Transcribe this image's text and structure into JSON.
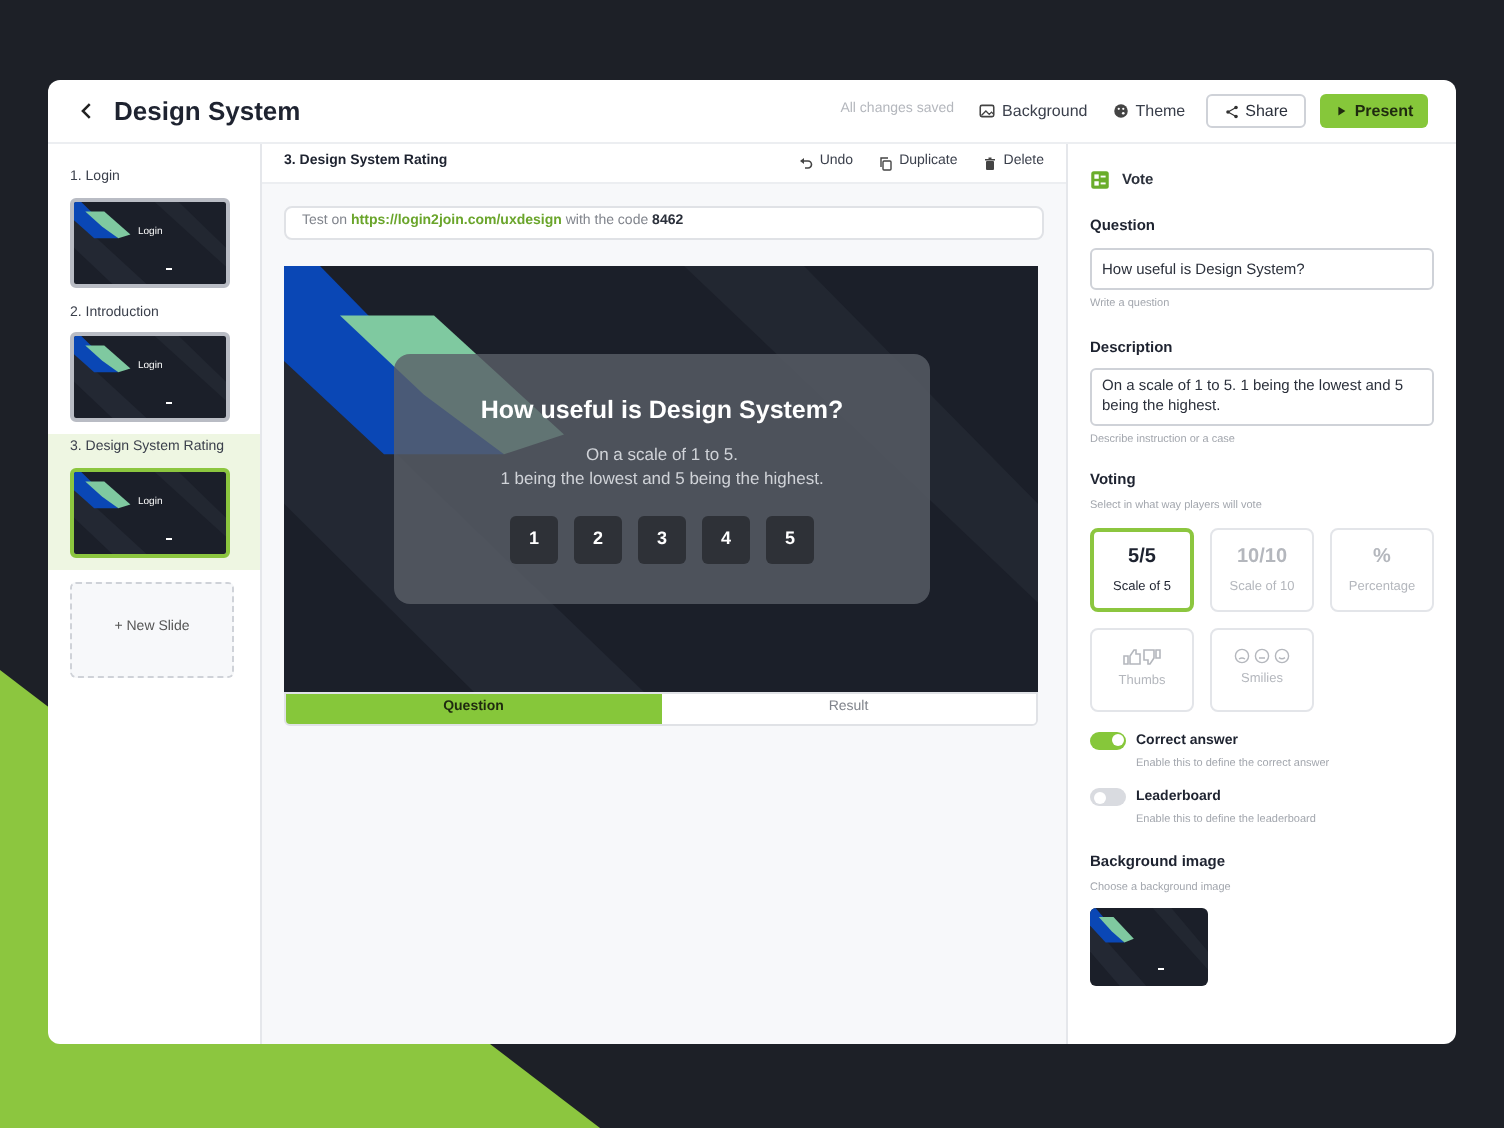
{
  "header": {
    "title": "Design System",
    "save_status": "All changes saved",
    "actions": [
      {
        "kind": "image",
        "label": "Background"
      },
      {
        "kind": "palette",
        "label": "Theme"
      }
    ],
    "share": "Share",
    "present": "Present"
  },
  "sidebar": {
    "slides": [
      {
        "label": "1. Login",
        "thumbnail_text": "Login",
        "selected": false
      },
      {
        "label": "2. Introduction",
        "thumbnail_text": "Login",
        "selected": false
      },
      {
        "label": "3. Design System Rating",
        "thumbnail_text": "Login",
        "selected": true
      }
    ],
    "new_slide": "+ New Slide"
  },
  "toolbar": {
    "title": "3. Design System Rating",
    "actions": [
      {
        "kind": "undo",
        "label": "Undo"
      },
      {
        "kind": "copy",
        "label": "Duplicate"
      },
      {
        "kind": "trash",
        "label": "Delete"
      }
    ]
  },
  "test_bar": {
    "prefix": "Test on",
    "url": "https://login2join.com/uxdesign",
    "suffix": "with the code **8462**"
  },
  "slide": {
    "question": "How useful is Design System?",
    "description_lines": [
      "On a scale of 1 to 5.",
      "1 being the lowest and 5 being the highest."
    ],
    "options": [
      "1",
      "2",
      "3",
      "4",
      "5"
    ]
  },
  "slide_tabs": [
    {
      "label": "Question",
      "selected": true
    },
    {
      "label": "Result",
      "selected": false
    }
  ],
  "panel": {
    "type_label": "Vote",
    "fields": [
      {
        "kind": "input",
        "label": "Question",
        "value": "How useful is Design System?",
        "hint": "Write a question"
      },
      {
        "kind": "textarea",
        "label": "Description",
        "value": "On a scale of 1 to 5. 1 being the lowest and 5 being the highest.",
        "hint": "Describe instruction or a case"
      }
    ],
    "voting": {
      "label": "Voting",
      "hint": "Select in what way players will vote",
      "options": [
        {
          "kind": "text",
          "symbol": "5/5",
          "label": "Scale of 5",
          "selected": true
        },
        {
          "kind": "text",
          "symbol": "10/10",
          "label": "Scale of 10",
          "selected": false
        },
        {
          "kind": "text",
          "symbol": "%",
          "label": "Percentage",
          "selected": false
        },
        {
          "kind": "thumbs",
          "label": "Thumbs",
          "selected": false
        },
        {
          "kind": "smilies",
          "label": "Smilies",
          "selected": false
        }
      ]
    },
    "toggles": [
      {
        "label": "Correct answer",
        "hint": "Enable this to define the correct answer",
        "on": true
      },
      {
        "label": "Leaderboard",
        "hint": "Enable this to define the leaderboard",
        "on": false
      }
    ],
    "background": {
      "label": "Background image",
      "hint": "Choose a background image"
    }
  }
}
